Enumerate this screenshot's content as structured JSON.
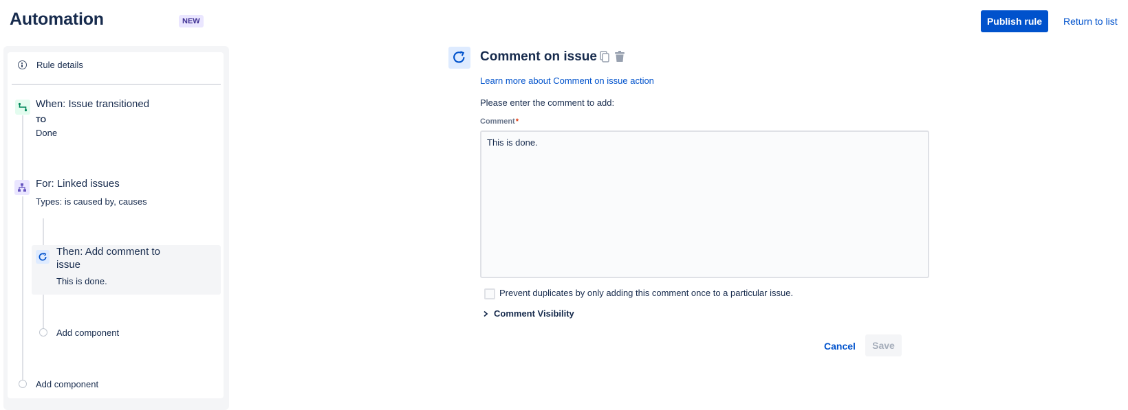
{
  "header": {
    "title": "Automation",
    "badge": "NEW",
    "publish_label": "Publish rule",
    "return_label": "Return to list"
  },
  "sidebar": {
    "rule_details_label": "Rule details",
    "trigger": {
      "title": "When: Issue transitioned",
      "sub_label": "TO",
      "sub_value": "Done",
      "icon": "transition-icon",
      "icon_color": "#00875a"
    },
    "branch": {
      "title": "For: Linked issues",
      "subtitle": "Types: is caused by, causes",
      "icon": "branch-icon",
      "icon_color": "#6554c0"
    },
    "action": {
      "title_line1": "Then: Add comment to",
      "title_line2": "issue",
      "subtitle": "This is done.",
      "icon": "comment-action-icon",
      "icon_color": "#0052cc"
    },
    "add_component_inner": "Add component",
    "add_component_outer": "Add component"
  },
  "editor": {
    "title": "Comment on issue",
    "learn_more": "Learn more about Comment on issue action",
    "prompt": "Please enter the comment to add:",
    "field_label": "Comment",
    "required_marker": "*",
    "comment_value": "This is done.",
    "prevent_duplicates_label": "Prevent duplicates by only adding this comment once to a particular issue.",
    "prevent_duplicates_checked": false,
    "visibility_label": "Comment Visibility",
    "cancel_label": "Cancel",
    "save_label": "Save"
  },
  "colors": {
    "primary": "#0052cc",
    "text": "#172b4d",
    "muted": "#6b778c",
    "required": "#de350b"
  }
}
